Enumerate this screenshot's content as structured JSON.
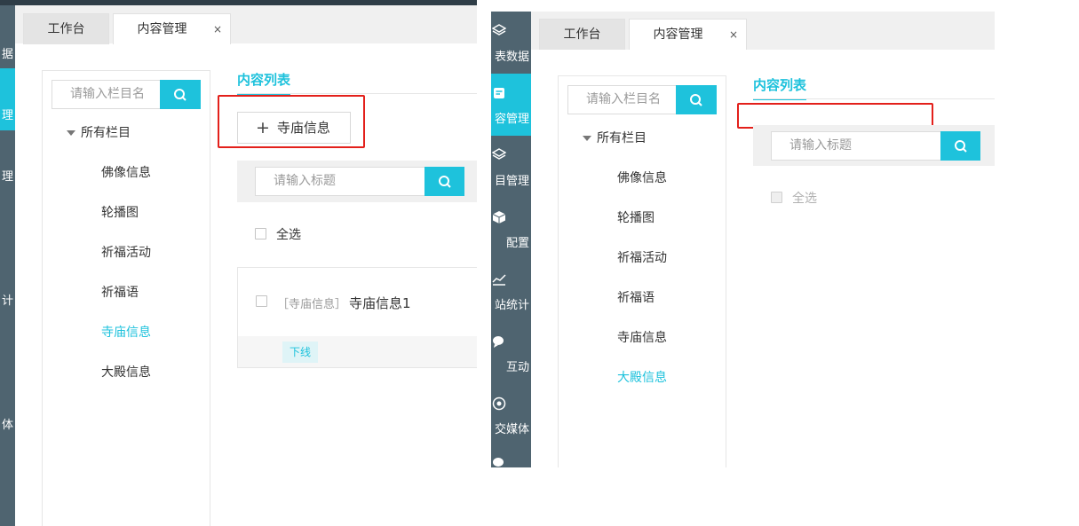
{
  "colors": {
    "accent": "#1ec2dc",
    "sidebar": "#4f6470",
    "highlight": "#e3201b"
  },
  "tabs": {
    "workbench": "工作台",
    "content_mgmt": "内容管理",
    "close": "×"
  },
  "left_sidebar": {
    "items": [
      "据",
      "理",
      "理",
      "计",
      "体"
    ]
  },
  "right_sidebar": {
    "items": [
      "表数据",
      "容管理",
      "目管理",
      "配置",
      "站统计",
      "互动",
      "交媒体"
    ]
  },
  "tree": {
    "search_placeholder": "请输入栏目名",
    "root": "所有栏目",
    "nodes": [
      "佛像信息",
      "轮播图",
      "祈福活动",
      "祈福语",
      "寺庙信息",
      "大殿信息"
    ]
  },
  "content": {
    "title": "内容列表",
    "add_button": "寺庙信息",
    "search_placeholder": "请输入标题",
    "select_all": "全选"
  },
  "card": {
    "tag": "［寺庙信息］",
    "title": "寺庙信息1",
    "badge": "下线"
  }
}
